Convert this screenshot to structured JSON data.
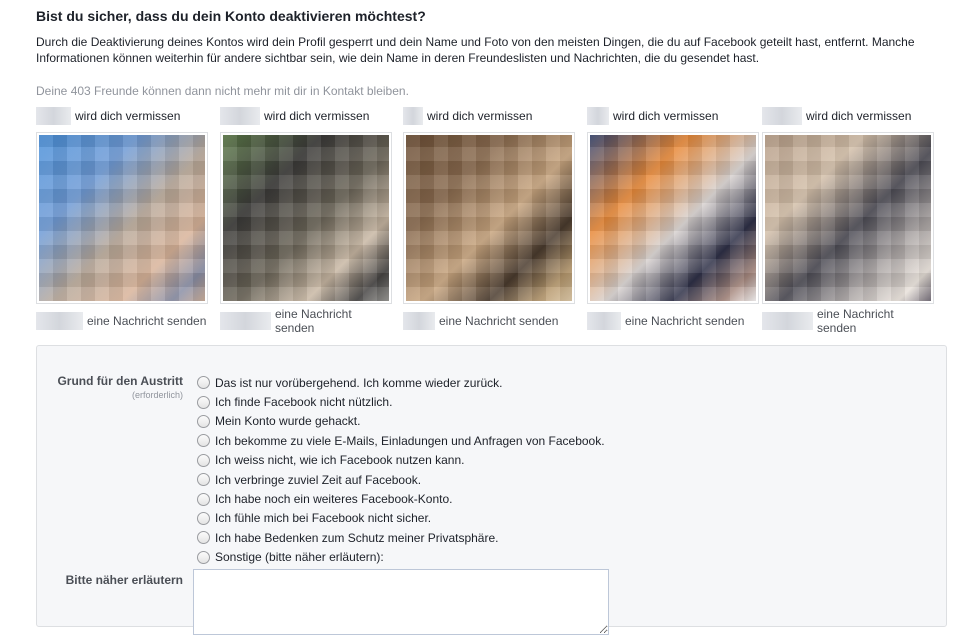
{
  "title": "Bist du sicher, dass du dein Konto deaktivieren möchtest?",
  "intro": "Durch die Deaktivierung deines Kontos wird dein Profil gesperrt und dein Name und Foto von den meisten Dingen, die du auf Facebook geteilt hast, entfernt. Manche Informationen können weiterhin für andere sichtbar sein, wie dein Name in deren Freundeslisten und Nachrichten, die du gesendet hast.",
  "friends_note": "Deine 403 Freunde können dann nicht mehr mit dir in Kontakt bleiben.",
  "friends": [
    {
      "miss_text": "wird dich vermissen",
      "message_link": "eine Nachricht senden",
      "photo_colors": [
        "#4a90d9",
        "#6f9bd6",
        "#b9a99a",
        "#d9b49a",
        "#8a8fa6",
        "#c2a38e"
      ]
    },
    {
      "miss_text": "wird dich vermissen",
      "message_link": "eine Nachricht senden",
      "photo_colors": [
        "#5d7a4a",
        "#3b3a38",
        "#6b6558",
        "#c9b8a4",
        "#474544",
        "#8d8c88"
      ]
    },
    {
      "miss_text": "wird dich vermissen",
      "message_link": "eine Nachricht senden",
      "photo_colors": [
        "#6b4e35",
        "#8a6b4f",
        "#c8a57f",
        "#4a3b2e",
        "#b89a6f",
        "#d9c3a0"
      ]
    },
    {
      "miss_text": "wird dich vermissen",
      "message_link": "eine Nachricht senden",
      "photo_colors": [
        "#3a4770",
        "#e88a3a",
        "#d7d1cf",
        "#2f3148",
        "#a88a80",
        "#f2efef"
      ]
    },
    {
      "miss_text": "wird dich vermissen",
      "message_link": "eine Nachricht senden",
      "photo_colors": [
        "#b59c86",
        "#d4c0aa",
        "#4d4c55",
        "#ada7a6",
        "#e8e1da",
        "#6b6470"
      ]
    }
  ],
  "form": {
    "reason_label": "Grund für den Austritt",
    "required_label": "(erforderlich)",
    "options": [
      "Das ist nur vorübergehend. Ich komme wieder zurück.",
      "Ich finde Facebook nicht nützlich.",
      "Mein Konto wurde gehackt.",
      "Ich bekomme zu viele E-Mails, Einladungen und Anfragen von Facebook.",
      "Ich weiss nicht, wie ich Facebook nutzen kann.",
      "Ich verbringe zuviel Zeit auf Facebook.",
      "Ich habe noch ein weiteres Facebook-Konto.",
      "Ich fühle mich bei Facebook nicht sicher.",
      "Ich habe Bedenken zum Schutz meiner Privatsphäre.",
      "Sonstige (bitte näher erläutern):"
    ],
    "explain_label": "Bitte näher erläutern",
    "explain_value": ""
  }
}
